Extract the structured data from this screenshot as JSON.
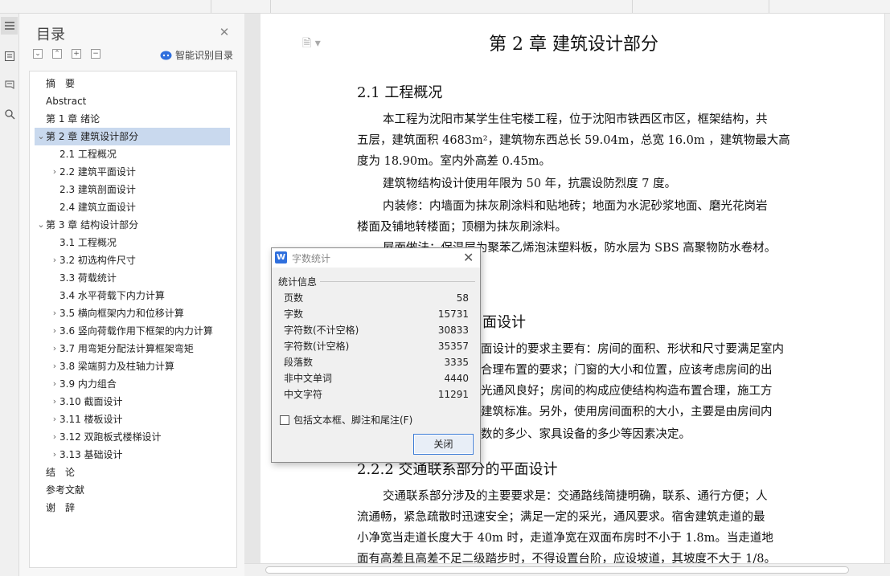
{
  "panel": {
    "title": "目录",
    "smart_label": "智能识别目录",
    "outline_tools": [
      "expand-all",
      "collapse-all",
      "add-item",
      "remove-item"
    ]
  },
  "toc": [
    {
      "label": "摘　要",
      "level": 0,
      "arrow": "",
      "selected": false
    },
    {
      "label": "Abstract",
      "level": 0,
      "arrow": "",
      "selected": false
    },
    {
      "label": "第 1 章  绪论",
      "level": 0,
      "arrow": "",
      "selected": false
    },
    {
      "label": "第 2 章  建筑设计部分",
      "level": 0,
      "arrow": "down",
      "selected": true
    },
    {
      "label": "2.1 工程概况",
      "level": 1,
      "arrow": "",
      "selected": false
    },
    {
      "label": "2.2 建筑平面设计",
      "level": 1,
      "arrow": "right",
      "selected": false
    },
    {
      "label": "2.3 建筑剖面设计",
      "level": 1,
      "arrow": "",
      "selected": false
    },
    {
      "label": "2.4 建筑立面设计",
      "level": 1,
      "arrow": "",
      "selected": false
    },
    {
      "label": "第 3 章  结构设计部分",
      "level": 0,
      "arrow": "down",
      "selected": false
    },
    {
      "label": "3.1 工程概况",
      "level": 1,
      "arrow": "",
      "selected": false
    },
    {
      "label": "3.2  初选构件尺寸",
      "level": 1,
      "arrow": "right",
      "selected": false
    },
    {
      "label": "3.3 荷载统计",
      "level": 1,
      "arrow": "",
      "selected": false
    },
    {
      "label": "3.4  水平荷载下内力计算",
      "level": 1,
      "arrow": "",
      "selected": false
    },
    {
      "label": "3.5 横向框架内力和位移计算",
      "level": 1,
      "arrow": "right",
      "selected": false
    },
    {
      "label": "3.6 竖向荷载作用下框架的内力计算",
      "level": 1,
      "arrow": "right",
      "selected": false
    },
    {
      "label": "3.7 用弯矩分配法计算框架弯矩",
      "level": 1,
      "arrow": "right",
      "selected": false
    },
    {
      "label": "3.8  梁端剪力及柱轴力计算",
      "level": 1,
      "arrow": "right",
      "selected": false
    },
    {
      "label": "3.9  内力组合",
      "level": 1,
      "arrow": "right",
      "selected": false
    },
    {
      "label": "3.10 截面设计",
      "level": 1,
      "arrow": "right",
      "selected": false
    },
    {
      "label": "3.11 楼板设计",
      "level": 1,
      "arrow": "right",
      "selected": false
    },
    {
      "label": "3.12 双跑板式楼梯设计",
      "level": 1,
      "arrow": "right",
      "selected": false
    },
    {
      "label": "3.13 基础设计",
      "level": 1,
      "arrow": "right",
      "selected": false
    },
    {
      "label": "结　论",
      "level": 0,
      "arrow": "",
      "selected": false
    },
    {
      "label": "参考文献",
      "level": 0,
      "arrow": "",
      "selected": false
    },
    {
      "label": "谢　辞",
      "level": 0,
      "arrow": "",
      "selected": false
    }
  ],
  "doc": {
    "chapter_title": "第 2 章  建筑设计部分",
    "h_2_1": "2.1 工程概况",
    "p1_l1": "本工程为沈阳市某学生住宅楼工程，位于沈阳市铁西区市区，框架结构，共",
    "p1_l2": "五层，建筑面积 4683m²，建筑物东西总长 59.04m，总宽 16.0m ，建筑物最大高",
    "p1_l3": "度为 18.90m。室内外高差 0.45m。",
    "p2": "建筑物结构设计使用年限为 50 年，抗震设防烈度 7 度。",
    "p3_l1": "内装修：内墙面为抹灰刷涂料和贴地砖；地面为水泥砂浆地面、磨光花岗岩",
    "p3_l2": "楼面及铺地转楼面；顶棚为抹灰刷涂料。",
    "p4_l1": "屋面做法：保温层为聚苯乙烯泡沫塑料板，防水层为 SBS 高聚物防水卷材。",
    "h_2_2_1_tail": "面设计",
    "p5_l1_tail": "面设计的要求主要有：房间的面积、形状和尺寸要满足室内",
    "p5_l2_tail": "合理布置的要求；门窗的大小和位置，应该考虑房间的出",
    "p5_l3_tail": "光通风良好；房间的构成应使结构构造布置合理，施工方",
    "p5_l4_tail": "建筑标准。另外，使用房间面积的大小，主要是由房间内",
    "p5_l5_tail": "数的多少、家具设备的多少等因素决定。",
    "h_2_2_2": "2.2.2 交通联系部分的平面设计",
    "p6_l1": "交通联系部分涉及的主要要求是：交通路线简捷明确，联系、通行方便；人",
    "p6_l2": "流通畅，紧急疏散时迅速安全；满足一定的采光，通风要求。宿舍建筑走道的最",
    "p6_l3": "小净宽当走道长度大于 40m 时，走道净宽在双面布房时不小于 1.8m。当走道地",
    "p6_l4": "面有高差且高差不足二级踏步时，不得设置台阶，应设坡道，其坡度不大于 1/8。"
  },
  "dialog": {
    "title": "字数统计",
    "group_label": "统计信息",
    "stats": [
      {
        "label": "页数",
        "value": "58"
      },
      {
        "label": "字数",
        "value": "15731"
      },
      {
        "label": "字符数(不计空格)",
        "value": "30833"
      },
      {
        "label": "字符数(计空格)",
        "value": "35357"
      },
      {
        "label": "段落数",
        "value": "3335"
      },
      {
        "label": "非中文单词",
        "value": "4440"
      },
      {
        "label": "中文字符",
        "value": "11291"
      }
    ],
    "checkbox_label": "包括文本框、脚注和尾注(F)",
    "close_button": "关闭"
  },
  "colors": {
    "selected_row": "#c9d9ee",
    "accent": "#2f6fdd"
  }
}
